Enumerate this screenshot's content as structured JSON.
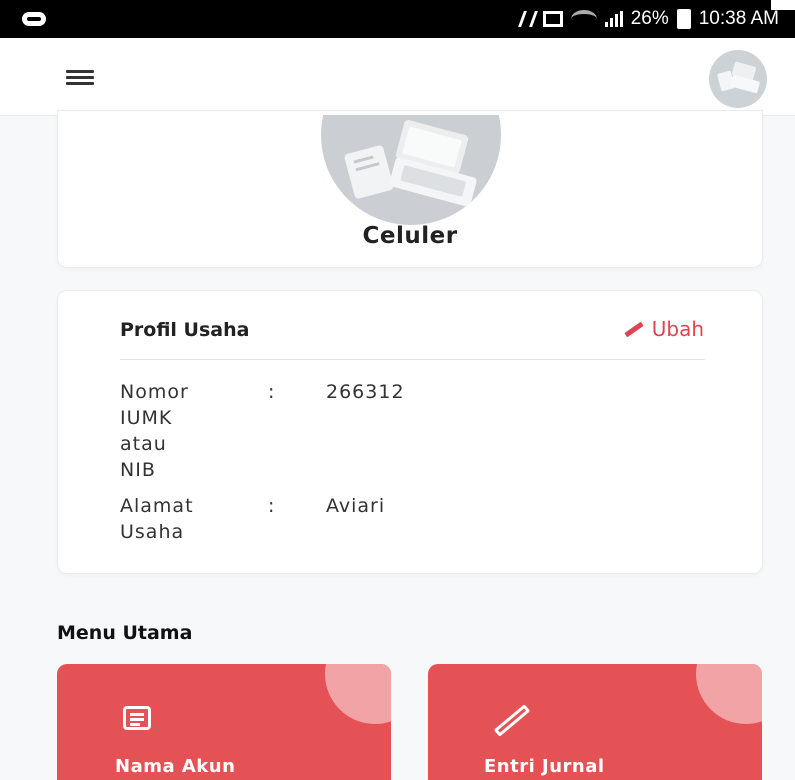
{
  "status_bar": {
    "battery": "26%",
    "time": "10:38 AM"
  },
  "app_bar": {
    "menu_icon": "hamburger-icon",
    "avatar_icon": "store-avatar-icon"
  },
  "store_card": {
    "name": "Celuler"
  },
  "profile_card": {
    "title": "Profil Usaha",
    "edit_label": "Ubah",
    "fields": [
      {
        "label": "Nomor\nIUMK\natau\nNIB",
        "separator": ":",
        "value": "266312"
      },
      {
        "label": "Alamat\nUsaha",
        "separator": ":",
        "value": "Aviari"
      }
    ]
  },
  "main_menu": {
    "title": "Menu Utama",
    "items": [
      {
        "label": "Nama Akun",
        "icon": "list-icon"
      },
      {
        "label": "Entri Jurnal",
        "icon": "pencil-icon"
      }
    ]
  },
  "colors": {
    "accent": "#e45255",
    "accent_light": "#f2a3a5",
    "link": "#e04452"
  }
}
